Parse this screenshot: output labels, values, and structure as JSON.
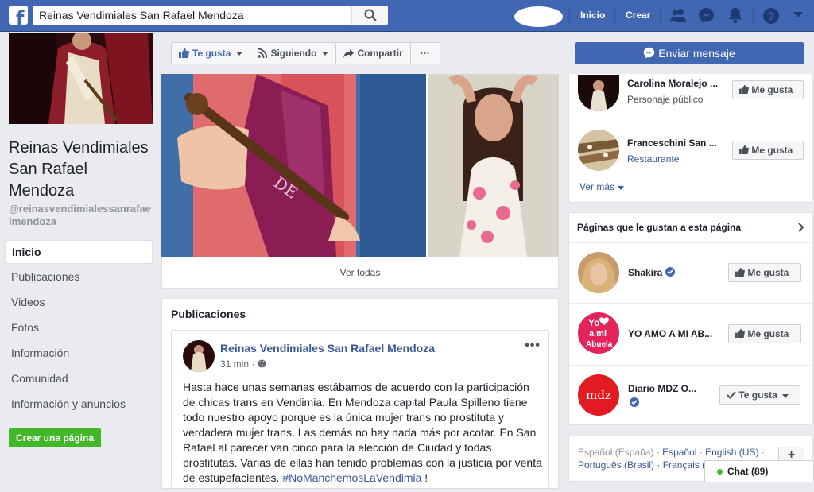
{
  "topbar": {
    "search_value": "Reinas Vendimiales San Rafael Mendoza",
    "nav": [
      "Inicio",
      "Crear"
    ],
    "icons": [
      "friends-icon",
      "messenger-icon",
      "notifications-icon",
      "help-icon",
      "dropdown-icon"
    ]
  },
  "page": {
    "name_line1": "Reinas Vendimiales",
    "name_line2": "San Rafael",
    "name_line3": "Mendoza",
    "handle": "@reinasvendimialessanrafaelmendoza"
  },
  "left_nav": [
    "Inicio",
    "Publicaciones",
    "Videos",
    "Fotos",
    "Información",
    "Comunidad",
    "Información y anuncios"
  ],
  "create_page_label": "Crear una página",
  "actions": {
    "like": "Te gusta",
    "following": "Siguiendo",
    "share": "Compartir",
    "more": "···",
    "message": "Enviar mensaje"
  },
  "photos": {
    "see_all": "Ver todas"
  },
  "posts": {
    "heading": "Publicaciones",
    "author": "Reinas Vendimiales San Rafael Mendoza",
    "time": "31 min",
    "text": "Hasta hace unas semanas estábamos de acuerdo con la participación de chicas trans en Vendimia. En Mendoza capital Paula Spilleno tiene todo nuestro apoyo porque es la única mujer trans no prostituta y verdadera mujer trans. Las demás no hay nada más por acotar. En San Rafael al parecer van cinco para la elección de Ciudad y todas prostitutas. Varias de ellas han tenido problemas con la justicia por venta de estupefacientes.",
    "hashtag": "#NoManchemosLaVendimia",
    "end": " !"
  },
  "related": [
    {
      "name": "Carolina Moralejo ...",
      "sub": "Personaje público",
      "button": "Me gusta"
    },
    {
      "name": "Franceschini San ...",
      "sub": "Restaurante",
      "button": "Me gusta"
    }
  ],
  "see_more": "Ver más",
  "liked_pages": {
    "heading": "Páginas que le gustan a esta página",
    "items": [
      {
        "name": "Shakira",
        "button": "Me gusta"
      },
      {
        "name": "YO AMO A MI AB...",
        "button": "Me gusta",
        "logo_line1": "Yo",
        "logo_line2": "a mi",
        "logo_line3": "Abuela"
      },
      {
        "name": "Diario MDZ O...",
        "button": "Te gusta",
        "logo": "mdz"
      }
    ]
  },
  "languages": {
    "line1_a": "Español (España)",
    "line1_b": "Español",
    "line1_c": "English (US)",
    "line2_a": "Português (Brasil)",
    "line2_b": "Français ("
  },
  "chat": {
    "label": "Chat (89)"
  },
  "colors": {
    "brand": "#4267b2",
    "link": "#385898",
    "green": "#42b72a"
  }
}
